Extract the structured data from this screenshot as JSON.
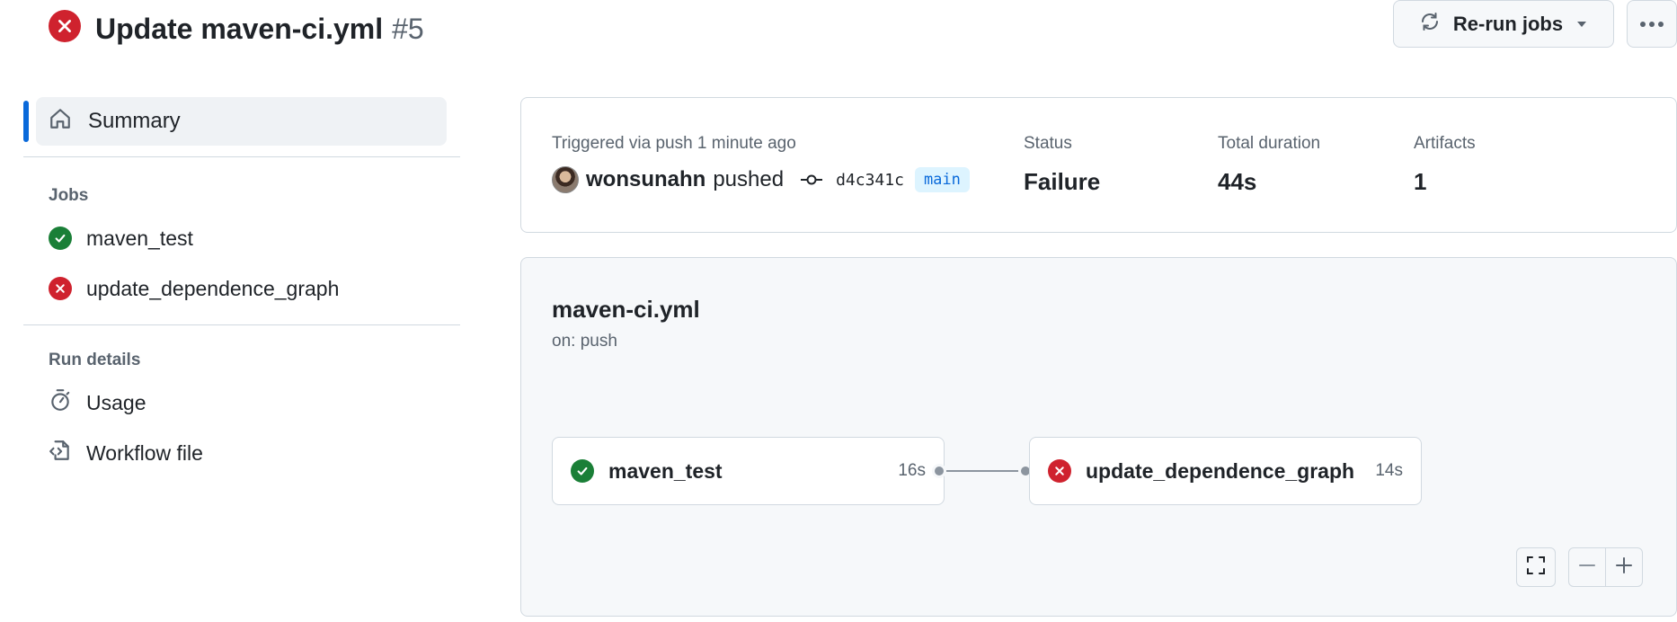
{
  "run": {
    "title": "Update maven-ci.yml",
    "number": "#5",
    "rerun_label": "Re-run jobs"
  },
  "sidebar": {
    "summary_label": "Summary",
    "jobs_title": "Jobs",
    "jobs": [
      {
        "label": "maven_test",
        "status": "success"
      },
      {
        "label": "update_dependence_graph",
        "status": "failure"
      }
    ],
    "run_details_title": "Run details",
    "details": [
      {
        "label": "Usage",
        "icon": "stopwatch-icon"
      },
      {
        "label": "Workflow file",
        "icon": "file-code-icon"
      }
    ]
  },
  "summary": {
    "trigger_text": "Triggered via push 1 minute ago",
    "actor": "wonsunahn",
    "action": "pushed",
    "commit_sha": "d4c341c",
    "branch": "main",
    "status_label": "Status",
    "status_value": "Failure",
    "duration_label": "Total duration",
    "duration_value": "44s",
    "artifacts_label": "Artifacts",
    "artifacts_value": "1"
  },
  "graph": {
    "workflow_file": "maven-ci.yml",
    "trigger": "on: push",
    "jobs": [
      {
        "name": "maven_test",
        "duration": "16s",
        "status": "success"
      },
      {
        "name": "update_dependence_graph",
        "duration": "14s",
        "status": "failure"
      }
    ]
  },
  "colors": {
    "failure": "#cf222e",
    "success": "#1a7f37",
    "accent": "#0969da"
  }
}
